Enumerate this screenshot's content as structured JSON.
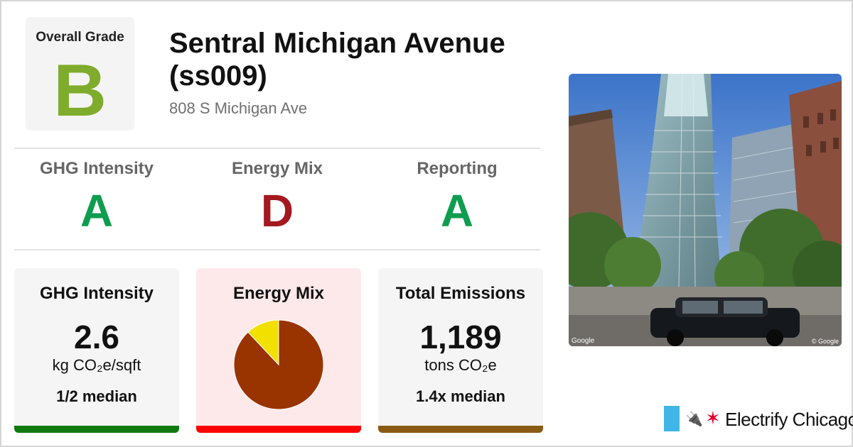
{
  "overall": {
    "label": "Overall Grade",
    "grade": "B",
    "color": "#7fac2c"
  },
  "building": {
    "name": "Sentral Michigan Avenue (ss009)",
    "address": "808 S Michigan Ave"
  },
  "grades": [
    {
      "name": "GHG Intensity",
      "grade": "A",
      "color": "#0e9d4f"
    },
    {
      "name": "Energy Mix",
      "grade": "D",
      "color": "#a3191f"
    },
    {
      "name": "Reporting",
      "grade": "A",
      "color": "#0e9d4f"
    }
  ],
  "cards": {
    "ghg": {
      "title": "GHG Intensity",
      "value": "2.6",
      "unit": "kg CO₂e/sqft",
      "median": "1/2 median",
      "bar_color": "#117a0f",
      "bg": "#f5f5f5"
    },
    "energy_mix": {
      "title": "Energy Mix",
      "bar_color": "#ff0000",
      "bg": "#fee9ea"
    },
    "emissions": {
      "title": "Total Emissions",
      "value": "1,189",
      "unit": "tons CO₂e",
      "median": "1.4x median",
      "bar_color": "#8b5a12",
      "bg": "#f5f5f5"
    }
  },
  "chart_data": {
    "type": "pie",
    "title": "",
    "slices": [
      {
        "value": 88,
        "color": "#993300"
      },
      {
        "value": 12,
        "color": "#f1e000"
      }
    ]
  },
  "photo": {
    "credit_left": "Google",
    "credit_right": "© Google"
  },
  "brand": {
    "name": "Electrify Chicago",
    "flag_color": "#41b6e6",
    "star_color": "#e4002b",
    "star_icon": "star-icon",
    "plug_icon": "plug-icon"
  }
}
